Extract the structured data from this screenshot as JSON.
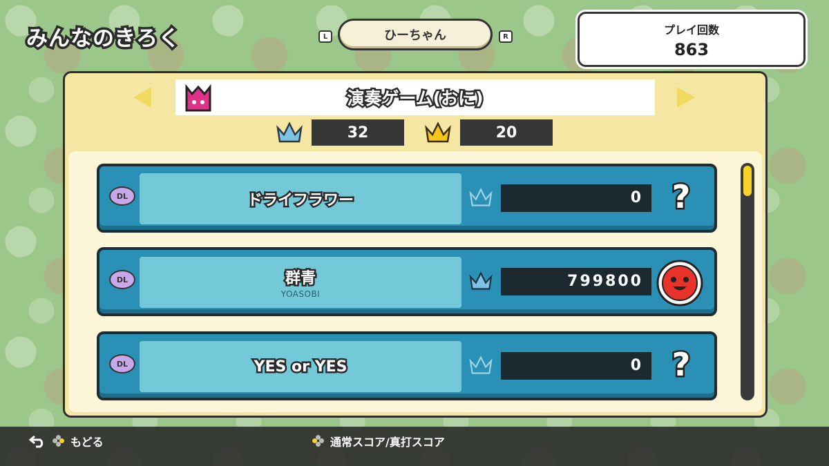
{
  "screen": {
    "title": "みんなのきろく"
  },
  "player": {
    "name": "ひーちゃん",
    "key_left": "L",
    "key_right": "R"
  },
  "play_count": {
    "label": "プレイ回数",
    "value": "863"
  },
  "mode": {
    "title": "演奏ゲーム(おに)"
  },
  "crowns": {
    "silver_count": "32",
    "gold_count": "20"
  },
  "songs": [
    {
      "badge": "DL",
      "title": "ドライフラワー",
      "artist": "",
      "score": "0",
      "crown": "empty",
      "status_icon": "question-icon",
      "status_text": "?"
    },
    {
      "badge": "DL",
      "title": "群青",
      "artist": "YOASOBI",
      "score": "799800",
      "crown": "silver",
      "status_icon": "don-face-icon",
      "status_text": ""
    },
    {
      "badge": "DL",
      "title": "YES or YES",
      "artist": "",
      "score": "0",
      "crown": "empty",
      "status_icon": "question-icon",
      "status_text": "?"
    }
  ],
  "footer": {
    "back_label": "もどる",
    "toggle_label": "通常スコア/真打スコア"
  },
  "colors": {
    "row_blue": "#2b90b5",
    "panel_cream": "#f6e6a4",
    "crown_silver": "#7ec3e6",
    "crown_gold": "#f5c518",
    "don_red": "#e8332a"
  }
}
